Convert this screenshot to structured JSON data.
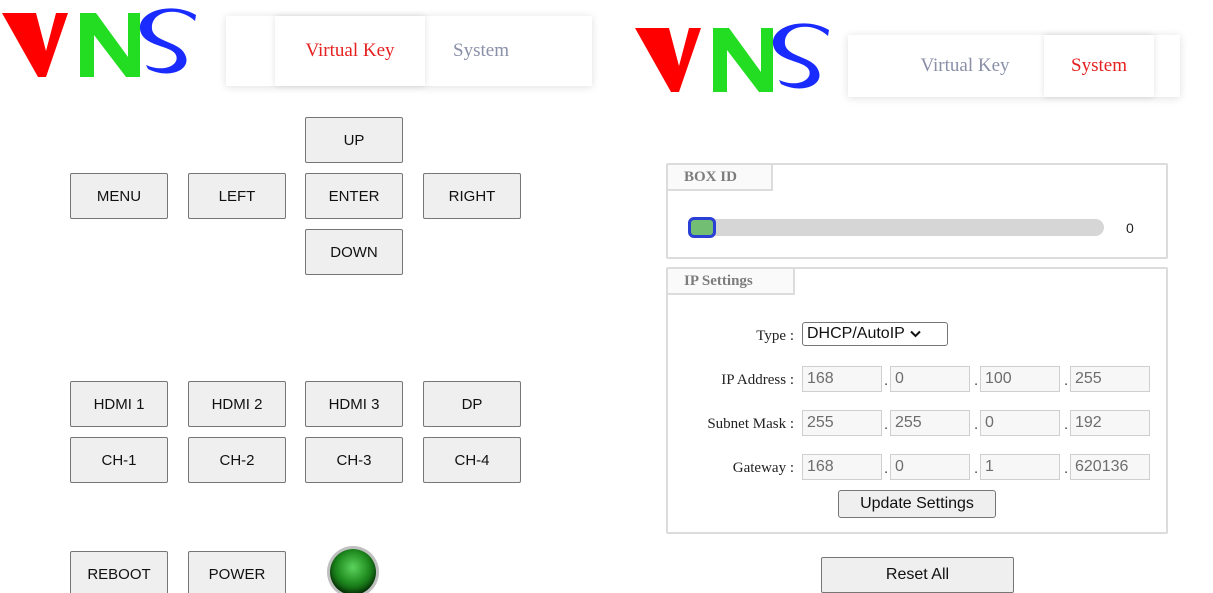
{
  "left_panel": {
    "nav": {
      "virtual_key": "Virtual Key",
      "system": "System",
      "active": "Virtual Key"
    },
    "dpad": {
      "up": "UP",
      "menu": "MENU",
      "left": "LEFT",
      "enter": "ENTER",
      "right": "RIGHT",
      "down": "DOWN"
    },
    "inputs": [
      "HDMI 1",
      "HDMI 2",
      "HDMI 3",
      "DP"
    ],
    "channels": [
      "CH-1",
      "CH-2",
      "CH-3",
      "CH-4"
    ],
    "power": {
      "reboot": "REBOOT",
      "power": "POWER"
    },
    "power_led": {
      "state": "on",
      "color": "#1f8b1f"
    }
  },
  "right_panel": {
    "nav": {
      "virtual_key": "Virtual Key",
      "system": "System",
      "active": "System"
    },
    "box_id": {
      "legend": "BOX ID",
      "value": "0",
      "slider_fraction": 0
    },
    "ip_settings": {
      "legend": "IP Settings",
      "type_label": "Type :",
      "type_value": "DHCP/AutoIP",
      "ip_address_label": "IP Address :",
      "ip_address": [
        "168",
        "0",
        "100",
        "255"
      ],
      "subnet_mask_label": "Subnet Mask :",
      "subnet_mask": [
        "255",
        "255",
        "0",
        "192"
      ],
      "gateway_label": "Gateway :",
      "gateway": [
        "168",
        "0",
        "1",
        "620136"
      ],
      "update_label": "Update Settings"
    },
    "reset_label": "Reset All"
  },
  "colors": {
    "logo_v": "#ff0000",
    "logo_n": "#22dd22",
    "logo_s": "#1a2bff",
    "active_tab": "#e62020",
    "inactive_tab": "#8a8fa8"
  }
}
